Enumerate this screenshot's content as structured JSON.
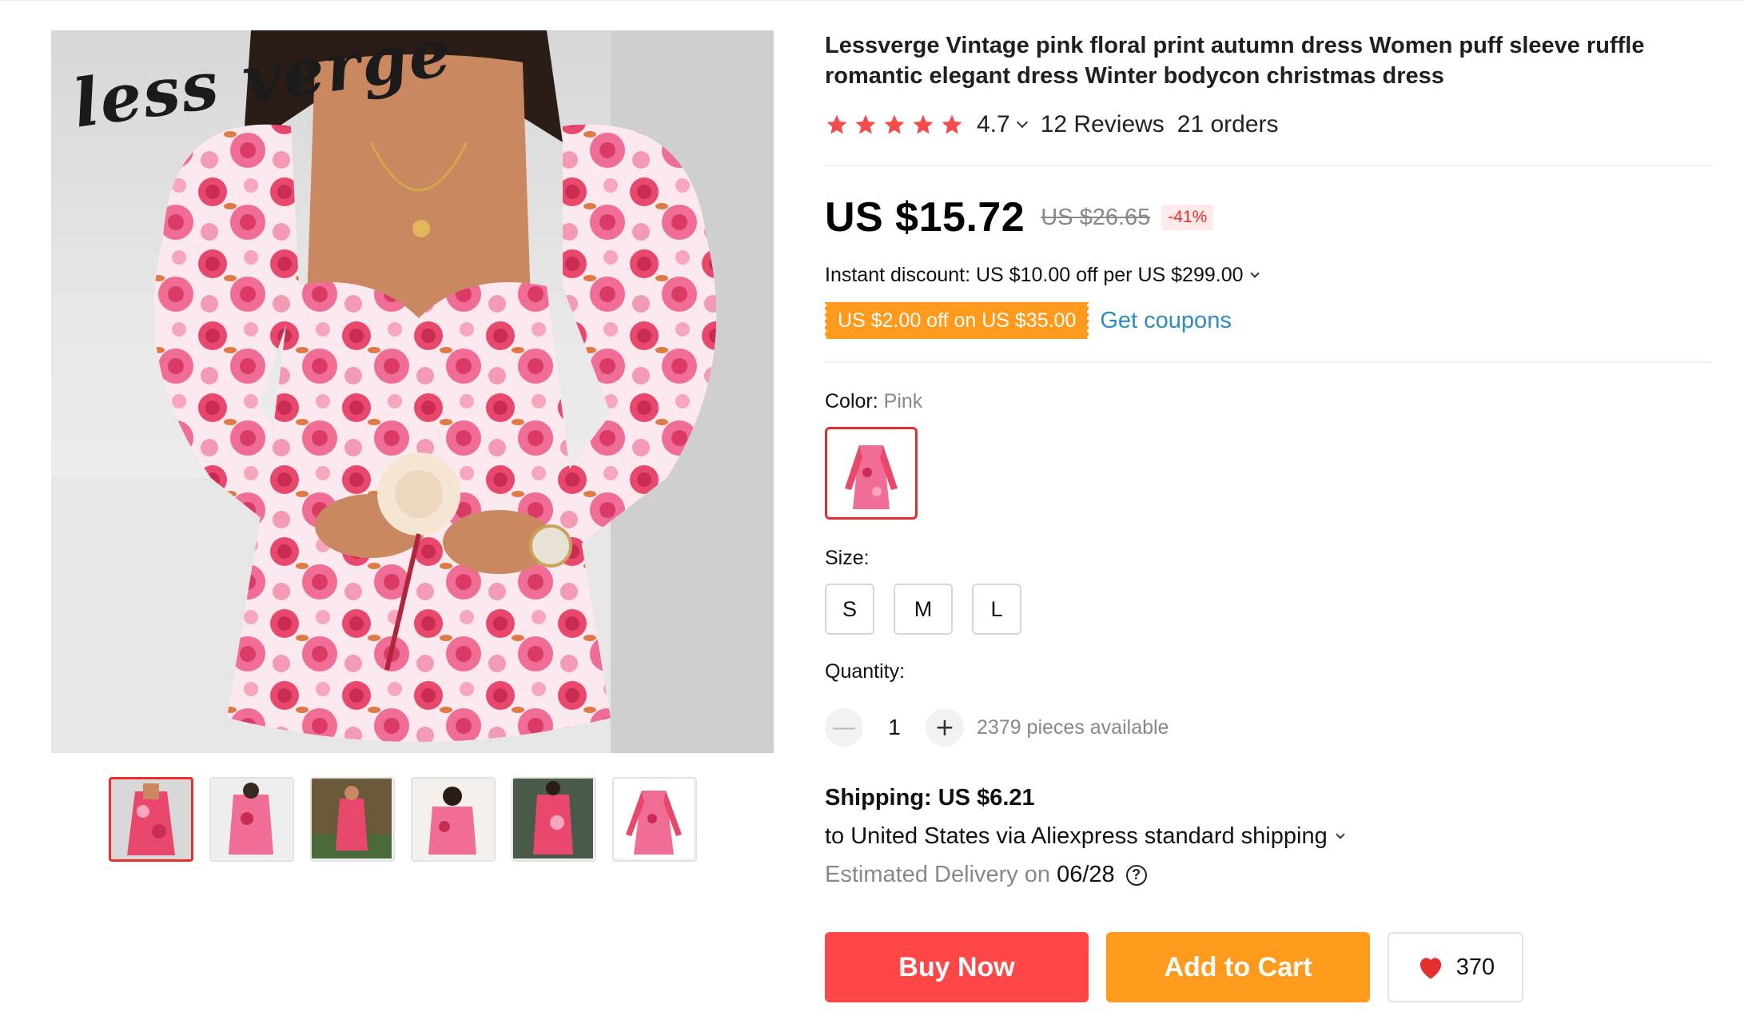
{
  "product": {
    "title": "Lessverge Vintage pink floral print autumn dress Women puff sleeve ruffle romantic elegant dress Winter bodycon christmas dress",
    "brand_watermark": "less verge",
    "rating": "4.7",
    "star_count": 5,
    "reviews": "12 Reviews",
    "orders": "21 orders"
  },
  "price": {
    "current": "US $15.72",
    "original": "US $26.65",
    "discount": "-41%"
  },
  "promotions": {
    "instant_discount": "Instant discount: US $10.00 off per US $299.00",
    "coupon": "US $2.00 off on US $35.00",
    "get_coupons": "Get coupons"
  },
  "options": {
    "color_label": "Color:",
    "color_value": "Pink",
    "size_label": "Size:",
    "sizes": [
      "S",
      "M",
      "L"
    ],
    "quantity_label": "Quantity:",
    "quantity": "1",
    "minus": "—",
    "plus": "+",
    "available": "2379 pieces available"
  },
  "shipping": {
    "title": "Shipping: US $6.21",
    "to": "to United States via Aliexpress standard shipping",
    "estimated_label": "Estimated Delivery on",
    "date": "06/28",
    "help": "?"
  },
  "actions": {
    "buy_now": "Buy Now",
    "add_to_cart": "Add to Cart",
    "wishlist_count": "370"
  },
  "gallery": {
    "thumbnail_count": 6,
    "selected_index": 0
  },
  "colors": {
    "accent_red": "#ff4747",
    "accent_orange": "#ff9a1c",
    "link_blue": "#2e8bc0",
    "star_red": "#f44b4b",
    "dress_pink": "#e8486b"
  },
  "icons": {
    "star": "star-icon",
    "heart": "heart-icon",
    "help": "question-circle-icon",
    "chevron": "chevron-down-icon"
  }
}
